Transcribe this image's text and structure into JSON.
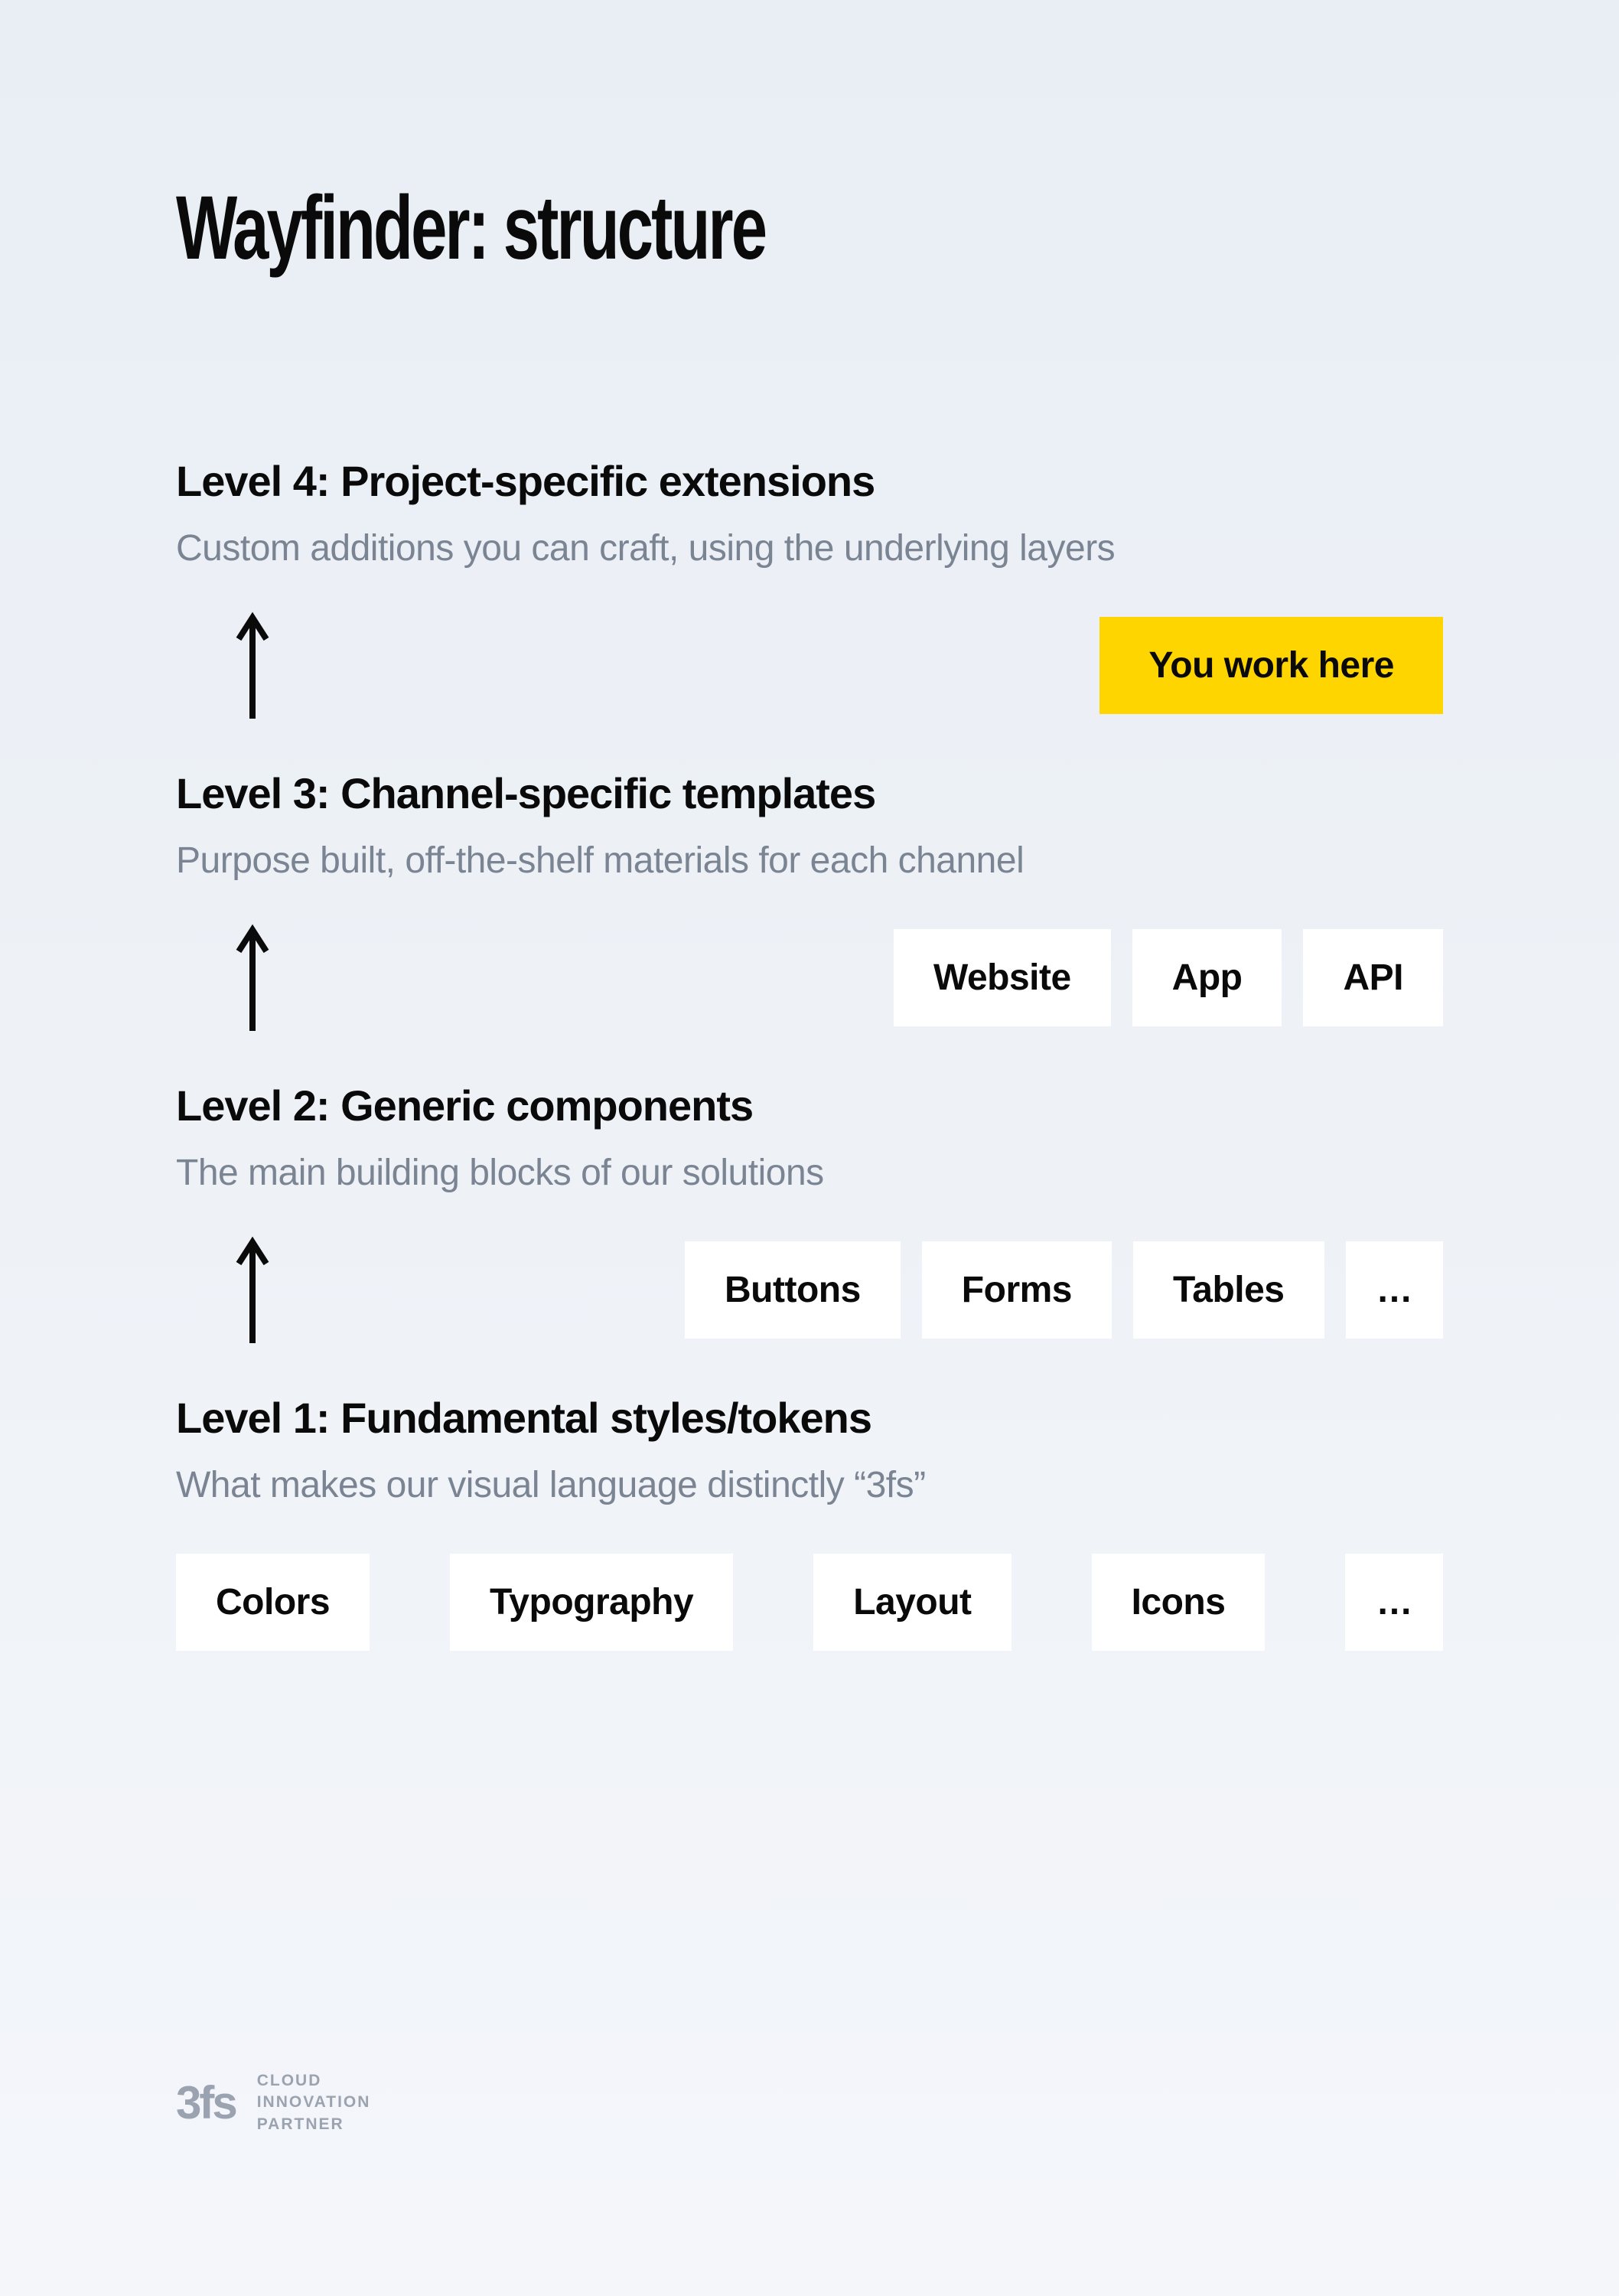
{
  "title": "Wayfinder: structure",
  "levels": {
    "l4": {
      "heading": "Level 4: Project-specific extensions",
      "subheading": "Custom additions you can craft, using the underlying layers",
      "badge": "You work here"
    },
    "l3": {
      "heading": "Level 3: Channel-specific templates",
      "subheading": "Purpose built, off-the-shelf materials for each channel",
      "chips": [
        "Website",
        "App",
        "API"
      ]
    },
    "l2": {
      "heading": "Level 2: Generic components",
      "subheading": "The main building blocks of our solutions",
      "chips": [
        "Buttons",
        "Forms",
        "Tables",
        "…"
      ]
    },
    "l1": {
      "heading": "Level 1: Fundamental styles/tokens",
      "subheading": "What makes our visual language distinctly “3fs”",
      "chips": [
        "Colors",
        "Typography",
        "Layout",
        "Icons",
        "…"
      ]
    }
  },
  "footer": {
    "logo": "3fs",
    "tagline": "CLOUD\nINNOVATION\nPARTNER"
  },
  "colors": {
    "accent": "#ffd500",
    "text": "#0a0a0a",
    "muted": "#7a8492",
    "chip_bg": "#ffffff"
  }
}
